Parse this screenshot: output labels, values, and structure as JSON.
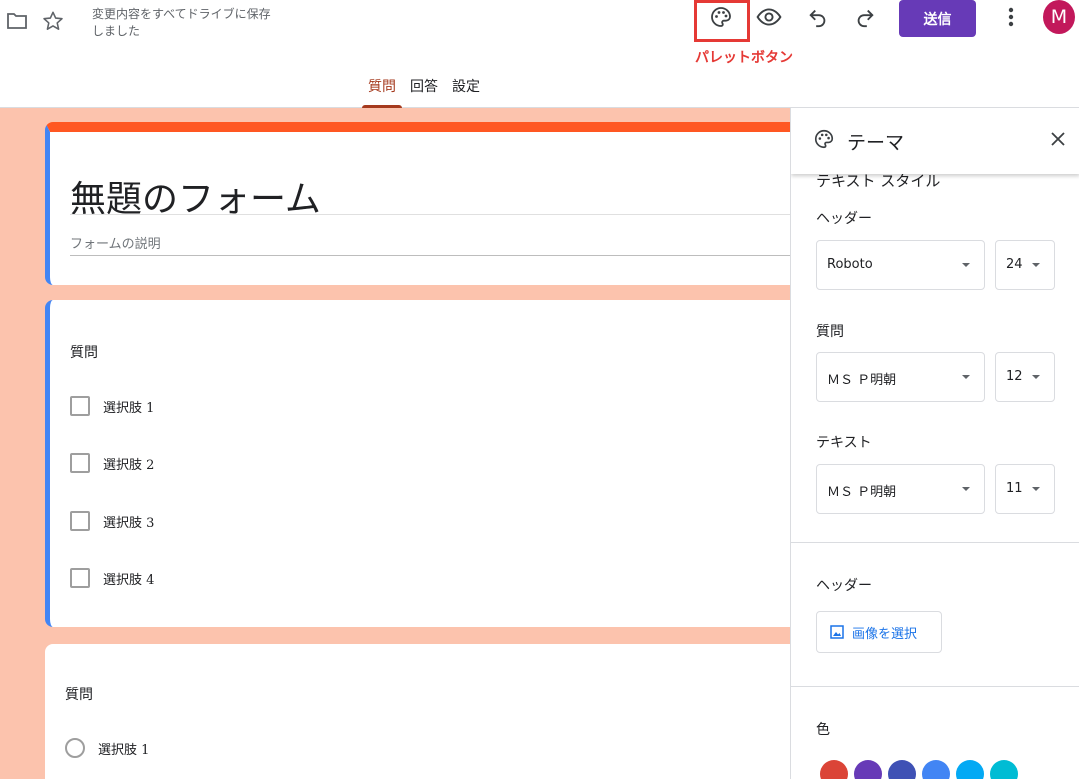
{
  "topbar": {
    "save_status": "変更内容をすべてドライブに保存しました",
    "palette_annotation": "パレットボタン",
    "send_label": "送信",
    "avatar_letter": "M"
  },
  "tabs": [
    {
      "label": "質問"
    },
    {
      "label": "回答"
    },
    {
      "label": "設定"
    }
  ],
  "form": {
    "title": "無題のフォーム",
    "description_placeholder": "フォームの説明",
    "questions": [
      {
        "title": "質問",
        "type": "checkbox",
        "options": [
          "選択肢 1",
          "選択肢 2",
          "選択肢 3",
          "選択肢 4"
        ]
      },
      {
        "title": "質問",
        "type": "radio",
        "options": [
          "選択肢 1"
        ]
      }
    ]
  },
  "theme_panel": {
    "title": "テーマ",
    "text_style_heading": "テキスト スタイル",
    "header_label": "ヘッダー",
    "header_font": "Roboto",
    "header_size": "24",
    "question_label": "質問",
    "question_font": "ＭＳ Ｐ明朝",
    "question_size": "12",
    "text_label": "テキスト",
    "text_font": "ＭＳ Ｐ明朝",
    "text_size": "11",
    "header_image_label": "ヘッダー",
    "choose_image_label": "画像を選択",
    "color_label": "色",
    "colors": [
      "#db4437",
      "#673ab7",
      "#3f51b5",
      "#4285f4",
      "#03a9f4",
      "#00bcd4"
    ]
  },
  "colors": {
    "accent": "#673ab7",
    "form_background": "#fcc3ad",
    "header_bar": "#ff5722",
    "active_tab": "#a53a1e",
    "annotation": "#e53935"
  }
}
